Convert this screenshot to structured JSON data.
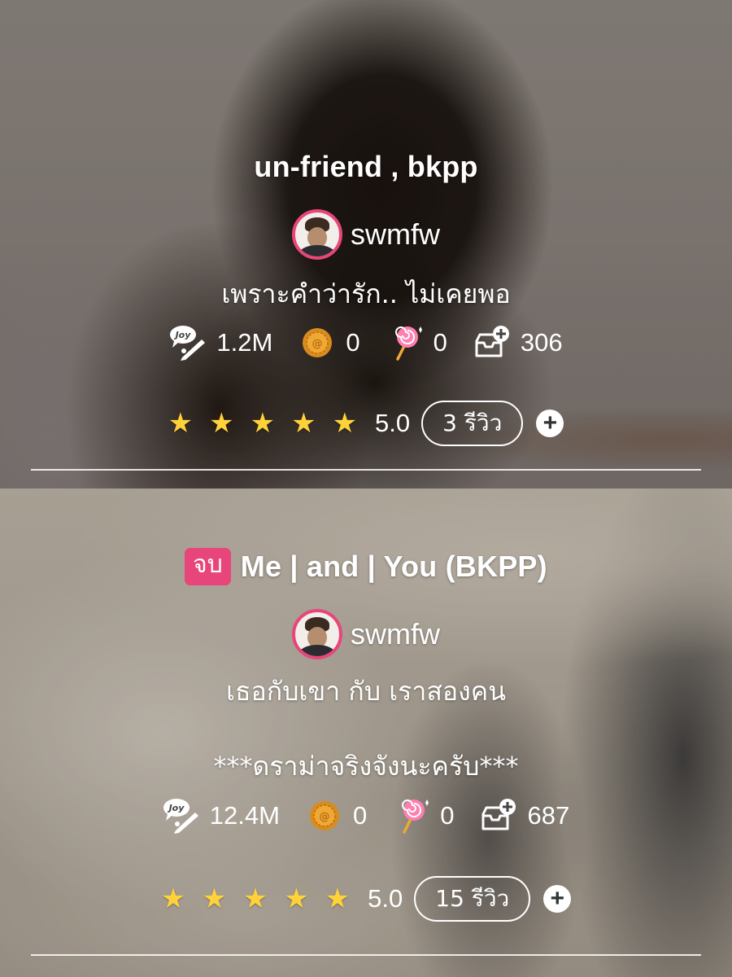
{
  "stories": [
    {
      "title": "un-friend , bkpp",
      "status_badge": "",
      "author": "swmfw",
      "description": "เพราะคำว่ารัก.. ไม่เคยพอ",
      "stats": {
        "views": "1.2M",
        "coins": "0",
        "lollipops": "0",
        "adds": "306"
      },
      "rating": "5.0",
      "star_count": 5,
      "reviews": "3 รีวิว",
      "add_label": "+"
    },
    {
      "title": "Me | and | You (BKPP)",
      "status_badge": "จบ",
      "author": "swmfw",
      "description": "เธอกับเขา กับ เราสองคน\n\n***ดราม่าจริงจังนะครับ***",
      "stats": {
        "views": "12.4M",
        "coins": "0",
        "lollipops": "0",
        "adds": "687"
      },
      "rating": "5.0",
      "star_count": 5,
      "reviews": "15 รีวิว",
      "add_label": "+"
    }
  ],
  "icons": {
    "star_glyph": "★",
    "view": "joy-pen-icon",
    "coin": "coin-icon",
    "lollipop": "lollipop-icon",
    "add_shelf": "add-to-shelf-icon"
  },
  "colors": {
    "accent": "#e8457a",
    "star": "#ffd23a"
  }
}
